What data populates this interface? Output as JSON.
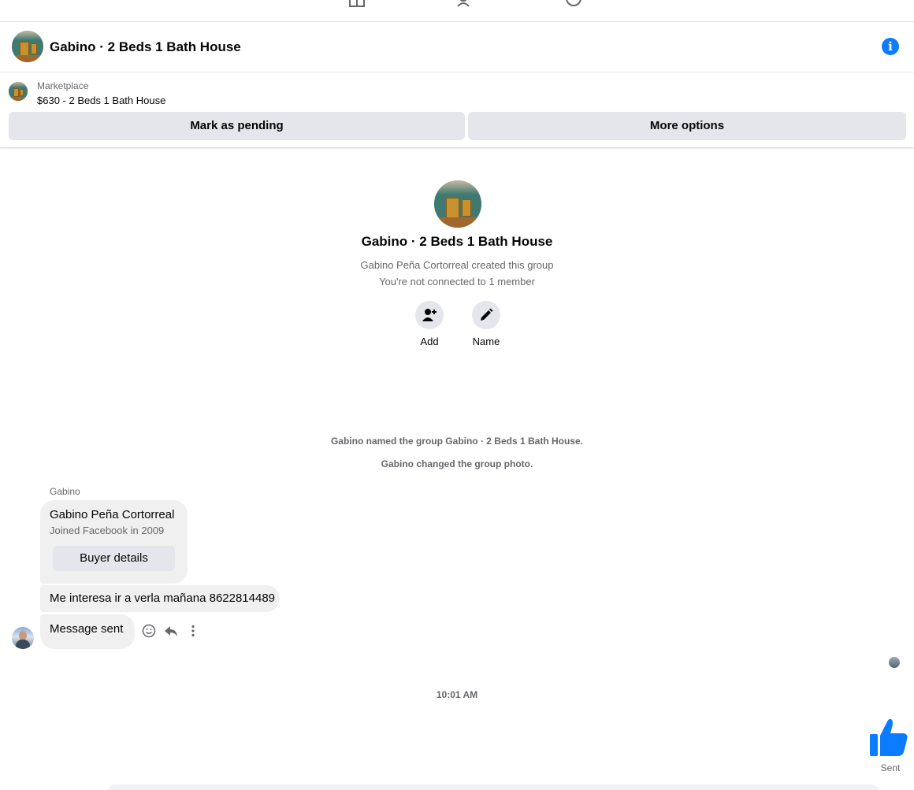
{
  "conversation": {
    "title": "Gabino · 2 Beds 1 Bath House"
  },
  "marketplace": {
    "label": "Marketplace",
    "item": "$630 - 2 Beds 1 Bath House",
    "mark_pending_label": "Mark as pending",
    "more_options_label": "More options"
  },
  "intro": {
    "title": "Gabino · 2 Beds 1 Bath House",
    "created_line": "Gabino Peña Cortorreal created this group",
    "connection_line": "You're not connected to 1 member",
    "add_label": "Add",
    "name_label": "Name"
  },
  "system_messages": [
    "Gabino named the group Gabino · 2 Beds 1 Bath House.",
    "Gabino changed the group photo."
  ],
  "messages": {
    "sender": "Gabino",
    "card": {
      "name": "Gabino Peña Cortorreal",
      "joined": "Joined Facebook in 2009",
      "button": "Buyer details"
    },
    "text1": "Me interesa ir a verla mañana 8622814489",
    "text2": "Message sent"
  },
  "timestamp": "10:01 AM",
  "sent_status": "Sent",
  "colors": {
    "accent": "#0a7cff",
    "bubble": "#f0f0f0",
    "button": "#e4e6eb",
    "muted_text": "#65676b"
  }
}
